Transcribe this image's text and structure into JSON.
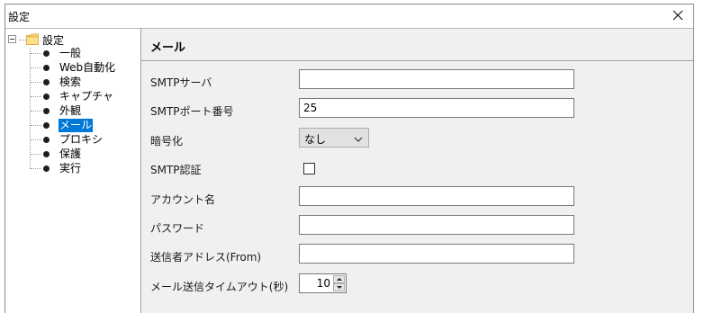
{
  "window": {
    "title": "設定",
    "close_icon": "close-icon"
  },
  "tree": {
    "root_label": "設定",
    "root_icon": "folder-icon",
    "items": [
      {
        "label": "一般"
      },
      {
        "label": "Web自動化"
      },
      {
        "label": "検索"
      },
      {
        "label": "キャプチャ"
      },
      {
        "label": "外観"
      },
      {
        "label": "メール"
      },
      {
        "label": "プロキシ"
      },
      {
        "label": "保護"
      },
      {
        "label": "実行"
      }
    ],
    "selected_index": 5,
    "selected_color": "#0078d7"
  },
  "panel": {
    "title": "メール",
    "fields": {
      "smtp_server": {
        "label": "SMTPサーバ",
        "value": ""
      },
      "smtp_port": {
        "label": "SMTPポート番号",
        "value": "25"
      },
      "encryption": {
        "label": "暗号化",
        "value": "なし"
      },
      "smtp_auth": {
        "label": "SMTP認証",
        "checked": false
      },
      "account_name": {
        "label": "アカウント名",
        "value": ""
      },
      "password": {
        "label": "パスワード",
        "value": ""
      },
      "sender_address": {
        "label": "送信者アドレス(From)",
        "value": ""
      },
      "timeout": {
        "label": "メール送信タイムアウト(秒)",
        "value": "10"
      }
    }
  }
}
